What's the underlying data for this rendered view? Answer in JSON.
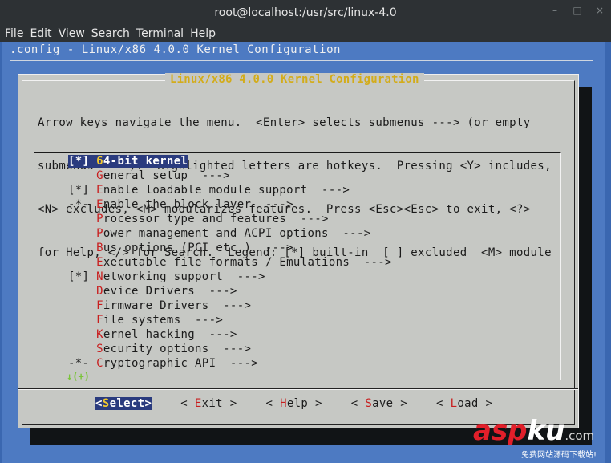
{
  "window": {
    "title": "root@localhost:/usr/src/linux-4.0",
    "controls": [
      "–",
      "□",
      "×"
    ]
  },
  "menubar": [
    "File",
    "Edit",
    "View",
    "Search",
    "Terminal",
    "Help"
  ],
  "config_title": ".config - Linux/x86 4.0.0 Kernel Configuration",
  "dialog": {
    "title": "Linux/x86 4.0.0 Kernel Configuration",
    "help_lines": [
      "Arrow keys navigate the menu.  <Enter> selects submenus ---> (or empty",
      "submenus ----).  Highlighted letters are hotkeys.  Pressing <Y> includes,",
      "<N> excludes, <M> modularizes features.  Press <Esc><Esc> to exit, <?>",
      "for Help, </> for Search.  Legend: [*] built-in  [ ] excluded  <M> module"
    ],
    "items": [
      {
        "prefix": "[*] ",
        "pre": "",
        "hot": "6",
        "rest": "4-bit kernel",
        "selected": true
      },
      {
        "prefix": "    ",
        "pre": "",
        "hot": "G",
        "rest": "eneral setup  --->"
      },
      {
        "prefix": "[*] ",
        "pre": "",
        "hot": "E",
        "rest": "nable loadable module support  --->"
      },
      {
        "prefix": "-*- ",
        "pre": "",
        "hot": "E",
        "rest": "nable the block layer  --->"
      },
      {
        "prefix": "    ",
        "pre": "",
        "hot": "P",
        "rest": "rocessor type and features  --->"
      },
      {
        "prefix": "    ",
        "pre": "",
        "hot": "P",
        "rest": "ower management and ACPI options  --->"
      },
      {
        "prefix": "    ",
        "pre": "",
        "hot": "B",
        "rest": "us options (PCI etc.)  --->"
      },
      {
        "prefix": "    ",
        "pre": "",
        "hot": "E",
        "rest": "xecutable file formats / Emulations  --->"
      },
      {
        "prefix": "[*] ",
        "pre": "",
        "hot": "N",
        "rest": "etworking support  --->"
      },
      {
        "prefix": "    ",
        "pre": "",
        "hot": "D",
        "rest": "evice Drivers  --->"
      },
      {
        "prefix": "    ",
        "pre": "",
        "hot": "F",
        "rest": "irmware Drivers  --->"
      },
      {
        "prefix": "    ",
        "pre": "",
        "hot": "F",
        "rest": "ile systems  --->"
      },
      {
        "prefix": "    ",
        "pre": "",
        "hot": "K",
        "rest": "ernel hacking  --->"
      },
      {
        "prefix": "    ",
        "pre": "",
        "hot": "S",
        "rest": "ecurity options  --->"
      },
      {
        "prefix": "-*- ",
        "pre": "",
        "hot": "C",
        "rest": "ryptographic API  --->"
      }
    ],
    "more_indicator": "↓(+)",
    "buttons": [
      {
        "open": "<",
        "hot": "S",
        "rest": "elect",
        "close": ">",
        "active": true
      },
      {
        "open": "< ",
        "hot": "E",
        "rest": "xit",
        "close": " >"
      },
      {
        "open": "< ",
        "hot": "H",
        "rest": "elp",
        "close": " >"
      },
      {
        "open": "< ",
        "hot": "S",
        "rest": "ave",
        "close": " >"
      },
      {
        "open": "< ",
        "hot": "L",
        "rest": "oad",
        "close": " >"
      }
    ]
  },
  "watermark": {
    "part1": "asp",
    "part2": "ku",
    "suffix": ".com",
    "sub": "免费网站源码下载站!"
  },
  "colors": {
    "terminal_bg": "#4d7ac2",
    "dialog_bg": "#c6c8c4",
    "dialog_title": "#d3ac1a",
    "hotkey": "#c81e1e",
    "selection": "#2a3b7e"
  }
}
